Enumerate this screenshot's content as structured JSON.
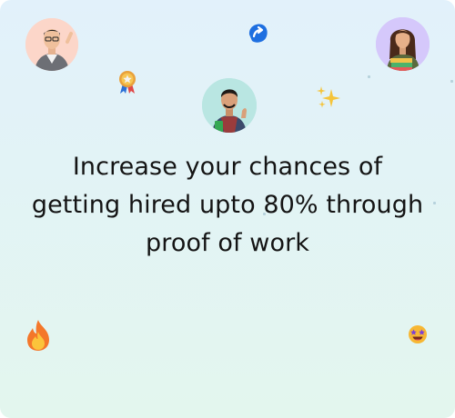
{
  "hero": {
    "headline_lines": [
      "Increase your chances of",
      "getting hired upto 80% through",
      "proof of work"
    ]
  },
  "decor": {
    "avatars": [
      "person-avatar",
      "person-avatar",
      "person-avatar"
    ],
    "stickers": [
      "blue-arrow-icon",
      "medal-icon",
      "sparkles-icon",
      "fire-icon",
      "star-struck-face-icon"
    ]
  },
  "colors": {
    "background_top": "#e2f1fb",
    "background_bottom": "#e3f6ee",
    "text": "#141414"
  }
}
